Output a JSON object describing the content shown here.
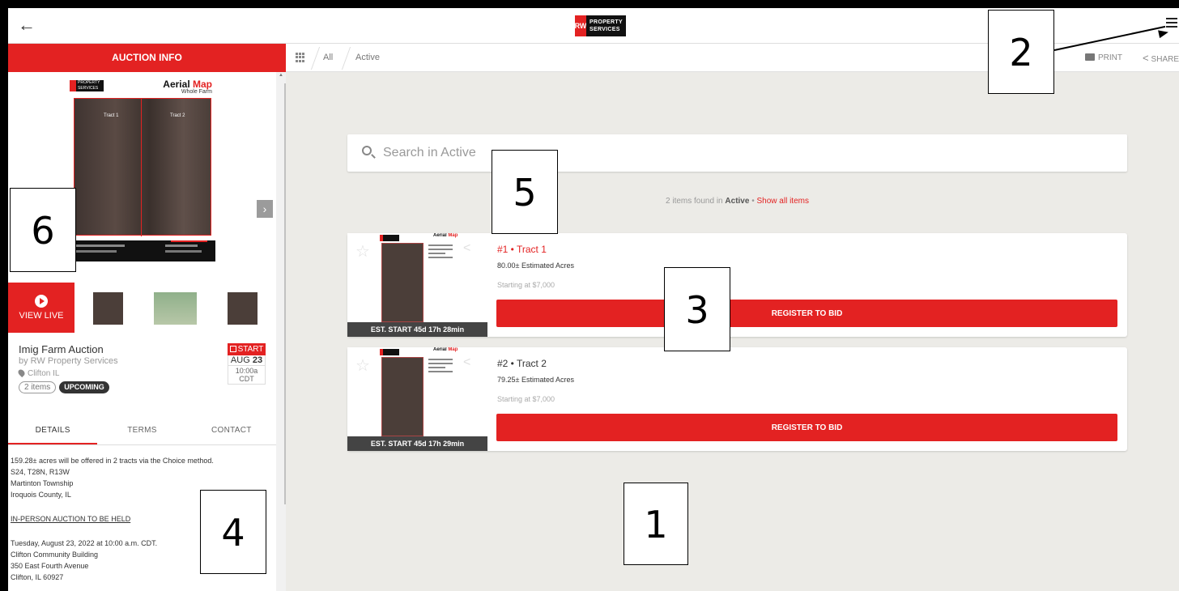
{
  "topbar": {
    "back_icon": "arrow-left-icon",
    "logo_mark": "RW",
    "logo_line1": "PROPERTY",
    "logo_line2": "SERVICES"
  },
  "sidebar": {
    "header": "AUCTION INFO",
    "hero": {
      "logo_line1": "PROPERTY",
      "logo_line2": "SERVICES",
      "title_part1": "Aerial",
      "title_part2": "Map",
      "subtitle": "Whole Farm",
      "tract1": "Tract 1",
      "tract2": "Tract 2"
    },
    "view_live": "VIEW LIVE",
    "auction": {
      "title": "Imig Farm Auction",
      "by": "by RW Property Services",
      "location": "Clifton IL",
      "items_chip": "2 items",
      "status_chip": "UPCOMING",
      "start_label": "START",
      "start_month": "AUG",
      "start_day": "23",
      "start_time": "10:00a CDT"
    },
    "tabs": [
      "DETAILS",
      "TERMS",
      "CONTACT"
    ],
    "description": {
      "line1": "159.28± acres will be offered in 2 tracts via the Choice method.",
      "line2": "S24, T28N, R13W",
      "line3": "Martinton Township",
      "line4": "Iroquois County, IL",
      "heading": "IN-PERSON AUCTION TO BE HELD",
      "line5": "Tuesday, August 23, 2022 at 10:00 a.m. CDT.",
      "line6": "Clifton Community Building",
      "line7": "350 East Fourth Avenue",
      "line8": "Clifton, IL 60927"
    }
  },
  "breadcrumb": {
    "all": "All",
    "active": "Active"
  },
  "toolbar": {
    "print": "PRINT",
    "share": "SHARE"
  },
  "search": {
    "placeholder": "Search in Active"
  },
  "results": {
    "count_text": "2 items found in",
    "filter": "Active",
    "separator": "•",
    "show_all": "Show all items"
  },
  "lots": [
    {
      "title": "#1 • Tract 1",
      "acres": "80.00± Estimated Acres",
      "starting": "Starting at $7,000",
      "button": "REGISTER TO BID",
      "est": "EST. START 45d 17h 28min",
      "map_title_1": "Aerial",
      "map_title_2": "Map"
    },
    {
      "title": "#2 • Tract 2",
      "acres": "79.25± Estimated Acres",
      "starting": "Starting at $7,000",
      "button": "REGISTER TO BID",
      "est": "EST. START 45d 17h 29min",
      "map_title_1": "Aerial",
      "map_title_2": "Map"
    }
  ],
  "annotations": [
    "1",
    "2",
    "3",
    "4",
    "5",
    "6"
  ],
  "colors": {
    "accent": "#e32222",
    "background": "#ecebe7"
  }
}
